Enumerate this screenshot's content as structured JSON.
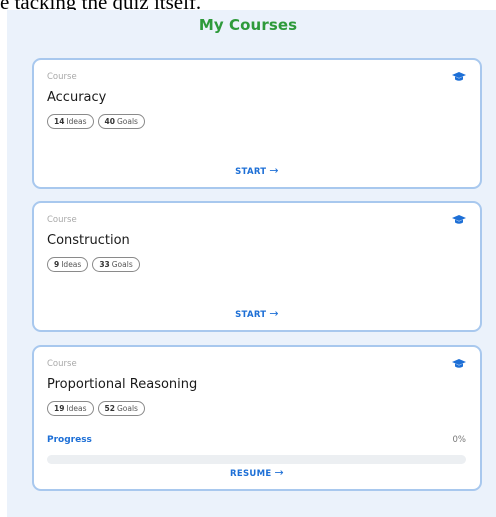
{
  "top_snippet": "e tacking the quiz itself.",
  "page_title": "My Courses",
  "courses": [
    {
      "label": "Course",
      "title": "Accuracy",
      "ideas_count": "14",
      "ideas_label": "Ideas",
      "goals_count": "40",
      "goals_label": "Goals",
      "action_label": "START",
      "icon": "graduation-cap-icon"
    },
    {
      "label": "Course",
      "title": "Construction",
      "ideas_count": "9",
      "ideas_label": "Ideas",
      "goals_count": "33",
      "goals_label": "Goals",
      "action_label": "START",
      "icon": "graduation-cap-icon"
    },
    {
      "label": "Course",
      "title": "Proportional Reasoning",
      "ideas_count": "19",
      "ideas_label": "Ideas",
      "goals_count": "52",
      "goals_label": "Goals",
      "progress_label": "Progress",
      "progress_text": "0%",
      "progress_value": 0,
      "action_label": "RESUME",
      "icon": "graduation-cap-icon"
    }
  ],
  "colors": {
    "title_green": "#2e9a3a",
    "accent_blue": "#1d6fd6",
    "card_border": "#a8c8ee",
    "panel_bg": "#ebf2fb"
  }
}
